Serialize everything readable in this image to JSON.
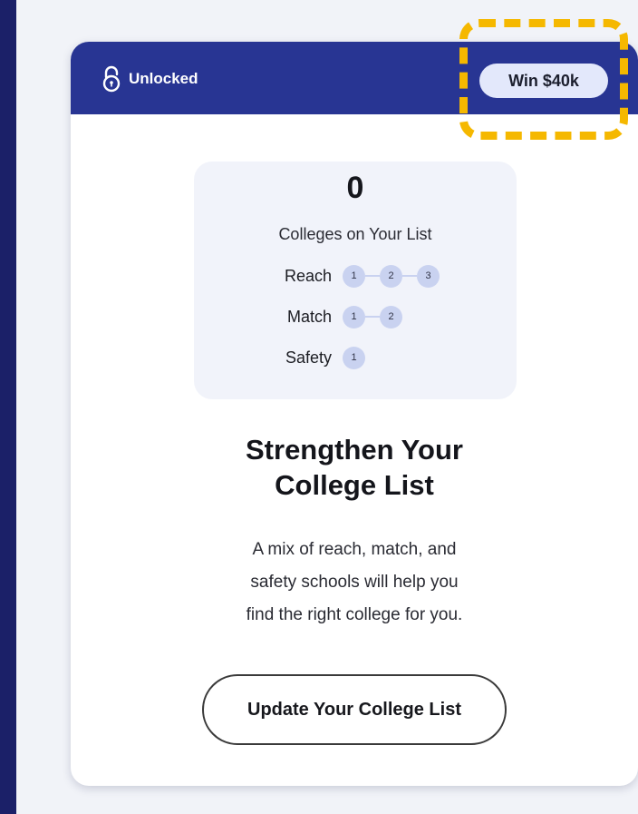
{
  "header": {
    "status_label": "Unlocked",
    "badge_label": "Win $40k"
  },
  "stats": {
    "count": "0",
    "count_label": "Colleges on Your List",
    "tiers": [
      {
        "name": "Reach",
        "steps": [
          "1",
          "2",
          "3"
        ]
      },
      {
        "name": "Match",
        "steps": [
          "1",
          "2"
        ]
      },
      {
        "name": "Safety",
        "steps": [
          "1"
        ]
      }
    ]
  },
  "content": {
    "title_line1": "Strengthen Your",
    "title_line2": "College List",
    "desc_line1": "A mix of reach, match, and",
    "desc_line2": "safety schools will help you",
    "desc_line3": "find the right college for you."
  },
  "cta": {
    "label": "Update Your College List"
  },
  "colors": {
    "page_background": "#1b2068",
    "header": "#283593",
    "badge": "#e3e8fb",
    "highlight": "#f5b800",
    "step_dot": "#c9d2f0"
  },
  "icons": {
    "status": "unlocked-padlock-icon"
  }
}
